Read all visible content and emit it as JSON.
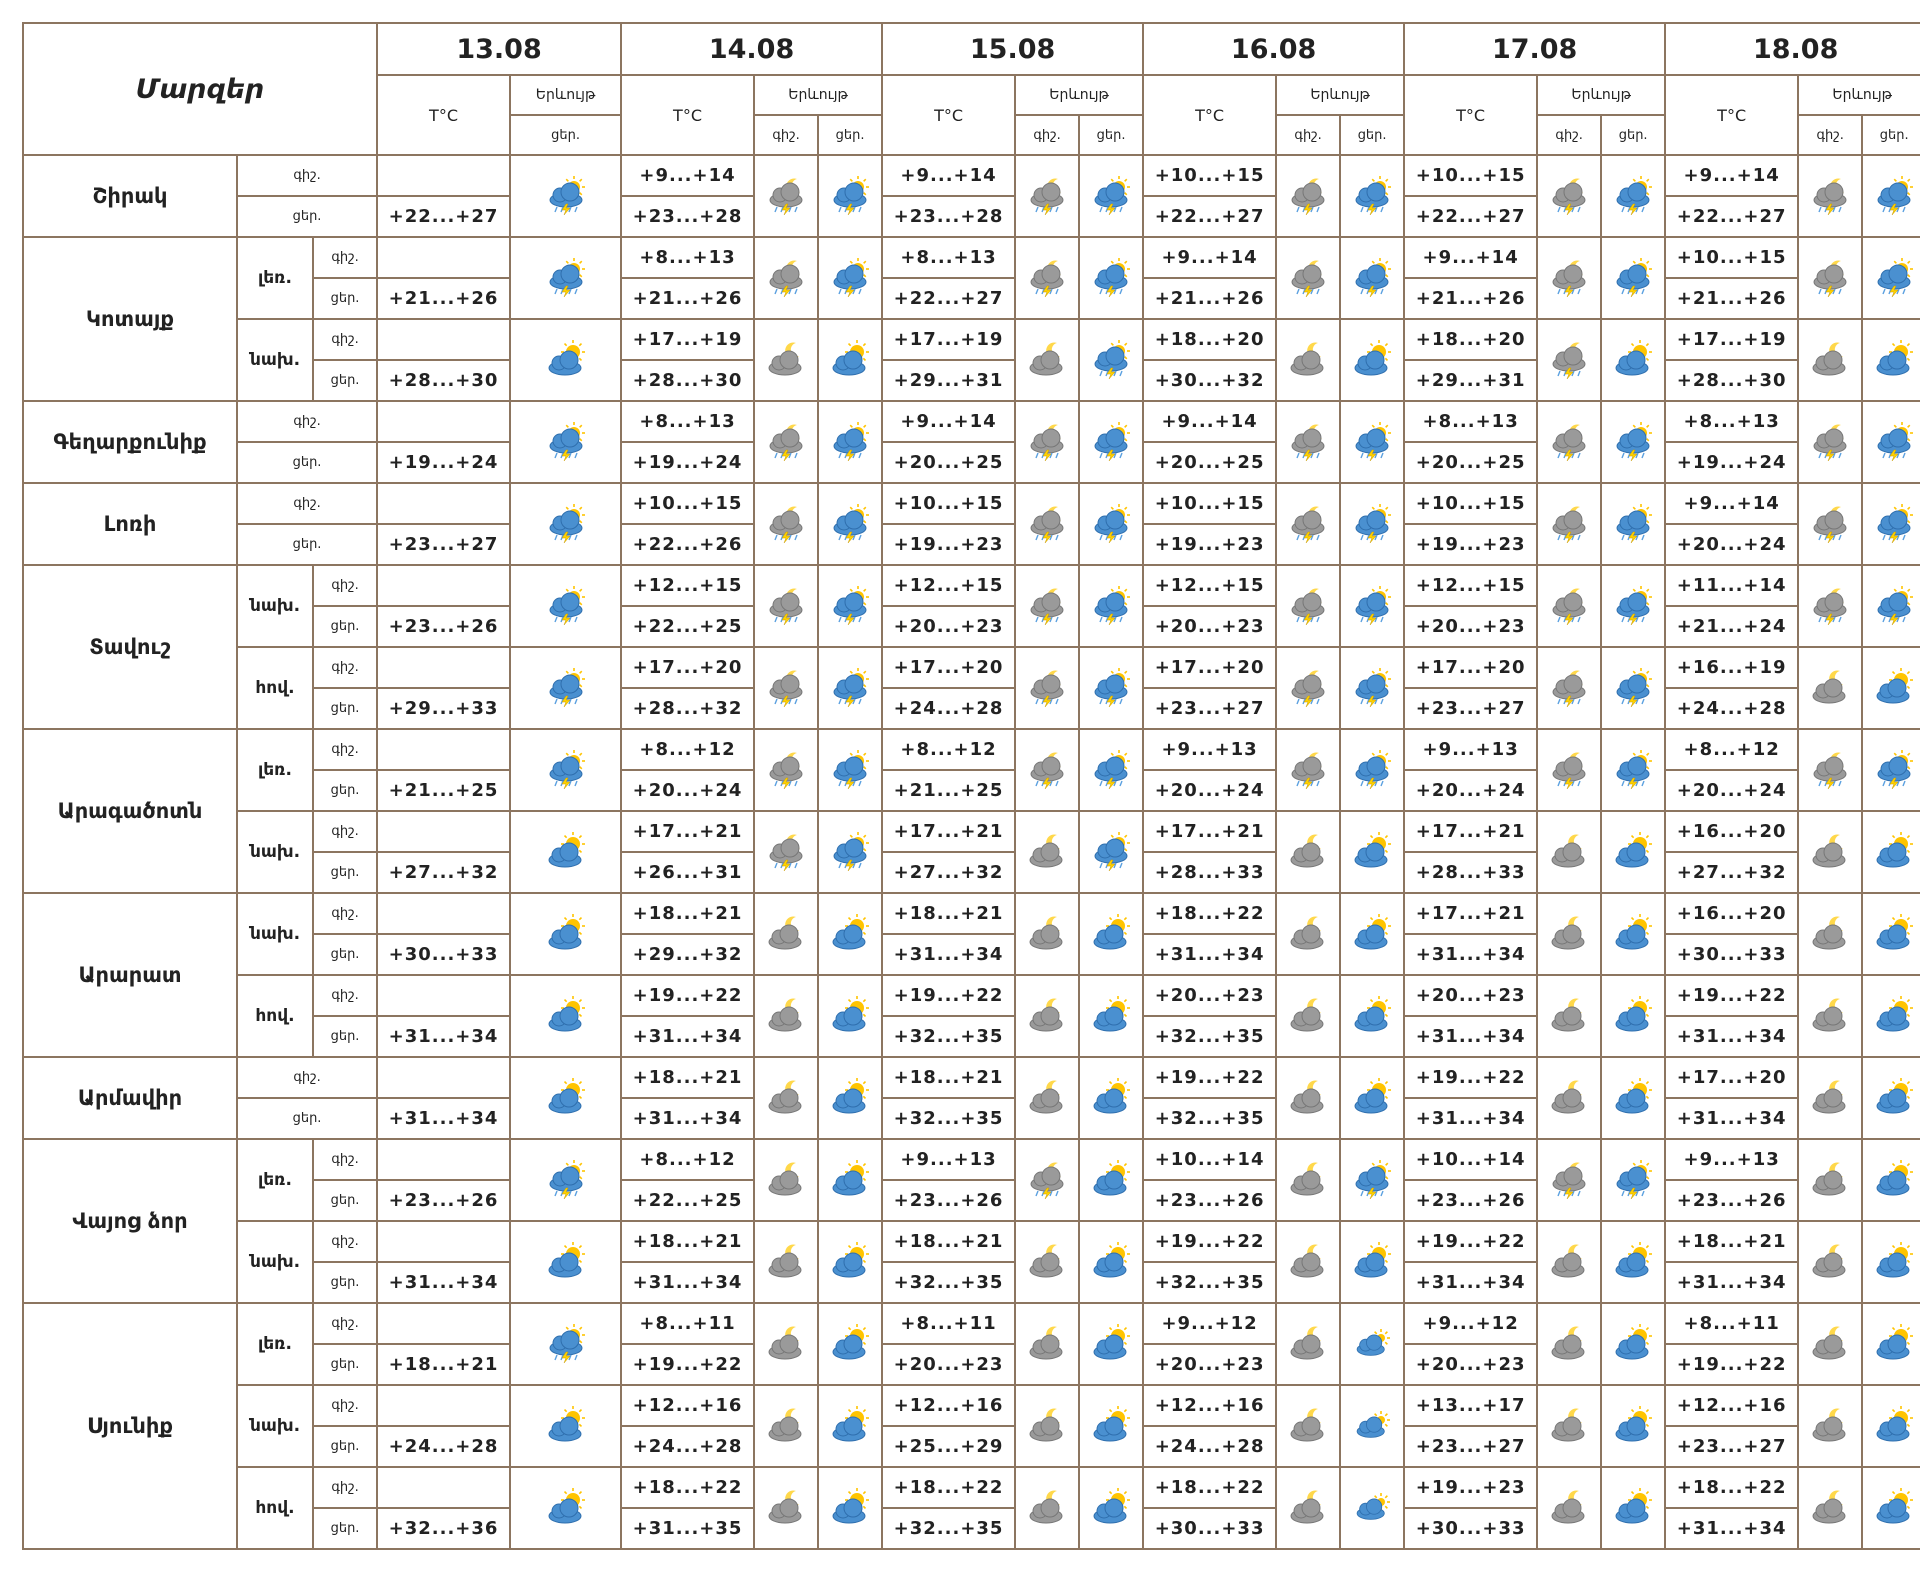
{
  "header": {
    "regions_label": "Մարզեր",
    "dates": [
      "13.08",
      "14.08",
      "15.08",
      "16.08",
      "17.08",
      "18.08"
    ],
    "temp_label": "T°C",
    "sky_label": "Երևույթ",
    "night": "գիշ.",
    "day": "ցեր."
  },
  "icon_types": {
    "storm-day": "partly sunny with lightning and rain",
    "storm-night": "night clouds with lightning and rain",
    "cloud-sun": "sun behind blue cloud",
    "cloud-moon": "moon behind grey cloud",
    "cloud-sun-small": "small sun behind blue cloud"
  },
  "colors": {
    "border": "#8c7560",
    "cloud_grey": "#9a9a9a",
    "cloud_blue": "#4a90d0",
    "sun": "#ffc400",
    "bolt": "#ffd200"
  },
  "regions": [
    {
      "name": "Շիրակ",
      "groups": [
        {
          "sub": "",
          "first": {
            "night": "",
            "day": "+22...+27",
            "icon": "storm-day"
          },
          "days": [
            {
              "night": "+9...+14",
              "day": "+23...+28",
              "ni": "storm-night",
              "di": "storm-day"
            },
            {
              "night": "+9...+14",
              "day": "+23...+28",
              "ni": "storm-night",
              "di": "storm-day"
            },
            {
              "night": "+10...+15",
              "day": "+22...+27",
              "ni": "storm-night",
              "di": "storm-day"
            },
            {
              "night": "+10...+15",
              "day": "+22...+27",
              "ni": "storm-night",
              "di": "storm-day"
            },
            {
              "night": "+9...+14",
              "day": "+22...+27",
              "ni": "storm-night",
              "di": "storm-day"
            }
          ]
        }
      ]
    },
    {
      "name": "Կոտայք",
      "groups": [
        {
          "sub": "լեռ.",
          "first": {
            "night": "",
            "day": "+21...+26",
            "icon": "storm-day"
          },
          "days": [
            {
              "night": "+8...+13",
              "day": "+21...+26",
              "ni": "storm-night",
              "di": "storm-day"
            },
            {
              "night": "+8...+13",
              "day": "+22...+27",
              "ni": "storm-night",
              "di": "storm-day"
            },
            {
              "night": "+9...+14",
              "day": "+21...+26",
              "ni": "storm-night",
              "di": "storm-day"
            },
            {
              "night": "+9...+14",
              "day": "+21...+26",
              "ni": "storm-night",
              "di": "storm-day"
            },
            {
              "night": "+10...+15",
              "day": "+21...+26",
              "ni": "storm-night",
              "di": "storm-day"
            }
          ]
        },
        {
          "sub": "նախ.",
          "first": {
            "night": "",
            "day": "+28...+30",
            "icon": "cloud-sun"
          },
          "days": [
            {
              "night": "+17...+19",
              "day": "+28...+30",
              "ni": "cloud-moon",
              "di": "cloud-sun"
            },
            {
              "night": "+17...+19",
              "day": "+29...+31",
              "ni": "cloud-moon",
              "di": "storm-day"
            },
            {
              "night": "+18...+20",
              "day": "+30...+32",
              "ni": "cloud-moon",
              "di": "cloud-sun"
            },
            {
              "night": "+18...+20",
              "day": "+29...+31",
              "ni": "storm-night",
              "di": "cloud-sun"
            },
            {
              "night": "+17...+19",
              "day": "+28...+30",
              "ni": "cloud-moon",
              "di": "cloud-sun"
            }
          ]
        }
      ]
    },
    {
      "name": "Գեղարքունիք",
      "groups": [
        {
          "sub": "",
          "first": {
            "night": "",
            "day": "+19...+24",
            "icon": "storm-day"
          },
          "days": [
            {
              "night": "+8...+13",
              "day": "+19...+24",
              "ni": "storm-night",
              "di": "storm-day"
            },
            {
              "night": "+9...+14",
              "day": "+20...+25",
              "ni": "storm-night",
              "di": "storm-day"
            },
            {
              "night": "+9...+14",
              "day": "+20...+25",
              "ni": "storm-night",
              "di": "storm-day"
            },
            {
              "night": "+8...+13",
              "day": "+20...+25",
              "ni": "storm-night",
              "di": "storm-day"
            },
            {
              "night": "+8...+13",
              "day": "+19...+24",
              "ni": "storm-night",
              "di": "storm-day"
            }
          ]
        }
      ]
    },
    {
      "name": "Լոռի",
      "groups": [
        {
          "sub": "",
          "first": {
            "night": "",
            "day": "+23...+27",
            "icon": "storm-day"
          },
          "days": [
            {
              "night": "+10...+15",
              "day": "+22...+26",
              "ni": "storm-night",
              "di": "storm-day"
            },
            {
              "night": "+10...+15",
              "day": "+19...+23",
              "ni": "storm-night",
              "di": "storm-day"
            },
            {
              "night": "+10...+15",
              "day": "+19...+23",
              "ni": "storm-night",
              "di": "storm-day"
            },
            {
              "night": "+10...+15",
              "day": "+19...+23",
              "ni": "storm-night",
              "di": "storm-day"
            },
            {
              "night": "+9...+14",
              "day": "+20...+24",
              "ni": "storm-night",
              "di": "storm-day"
            }
          ]
        }
      ]
    },
    {
      "name": "Տավուշ",
      "groups": [
        {
          "sub": "նախ.",
          "first": {
            "night": "",
            "day": "+23...+26",
            "icon": "storm-day"
          },
          "days": [
            {
              "night": "+12...+15",
              "day": "+22...+25",
              "ni": "storm-night",
              "di": "storm-day"
            },
            {
              "night": "+12...+15",
              "day": "+20...+23",
              "ni": "storm-night",
              "di": "storm-day"
            },
            {
              "night": "+12...+15",
              "day": "+20...+23",
              "ni": "storm-night",
              "di": "storm-day"
            },
            {
              "night": "+12...+15",
              "day": "+20...+23",
              "ni": "storm-night",
              "di": "storm-day"
            },
            {
              "night": "+11...+14",
              "day": "+21...+24",
              "ni": "storm-night",
              "di": "storm-day"
            }
          ]
        },
        {
          "sub": "հով.",
          "first": {
            "night": "",
            "day": "+29...+33",
            "icon": "storm-day"
          },
          "days": [
            {
              "night": "+17...+20",
              "day": "+28...+32",
              "ni": "storm-night",
              "di": "storm-day"
            },
            {
              "night": "+17...+20",
              "day": "+24...+28",
              "ni": "storm-night",
              "di": "storm-day"
            },
            {
              "night": "+17...+20",
              "day": "+23...+27",
              "ni": "storm-night",
              "di": "storm-day"
            },
            {
              "night": "+17...+20",
              "day": "+23...+27",
              "ni": "storm-night",
              "di": "storm-day"
            },
            {
              "night": "+16...+19",
              "day": "+24...+28",
              "ni": "cloud-moon",
              "di": "cloud-sun"
            }
          ]
        }
      ]
    },
    {
      "name": "Արագածոտն",
      "groups": [
        {
          "sub": "լեռ.",
          "first": {
            "night": "",
            "day": "+21...+25",
            "icon": "storm-day"
          },
          "days": [
            {
              "night": "+8...+12",
              "day": "+20...+24",
              "ni": "storm-night",
              "di": "storm-day"
            },
            {
              "night": "+8...+12",
              "day": "+21...+25",
              "ni": "storm-night",
              "di": "storm-day"
            },
            {
              "night": "+9...+13",
              "day": "+20...+24",
              "ni": "storm-night",
              "di": "storm-day"
            },
            {
              "night": "+9...+13",
              "day": "+20...+24",
              "ni": "storm-night",
              "di": "storm-day"
            },
            {
              "night": "+8...+12",
              "day": "+20...+24",
              "ni": "storm-night",
              "di": "storm-day"
            }
          ]
        },
        {
          "sub": "նախ.",
          "first": {
            "night": "",
            "day": "+27...+32",
            "icon": "cloud-sun"
          },
          "days": [
            {
              "night": "+17...+21",
              "day": "+26...+31",
              "ni": "storm-night",
              "di": "storm-day"
            },
            {
              "night": "+17...+21",
              "day": "+27...+32",
              "ni": "cloud-moon",
              "di": "storm-day"
            },
            {
              "night": "+17...+21",
              "day": "+28...+33",
              "ni": "cloud-moon",
              "di": "cloud-sun"
            },
            {
              "night": "+17...+21",
              "day": "+28...+33",
              "ni": "cloud-moon",
              "di": "cloud-sun"
            },
            {
              "night": "+16...+20",
              "day": "+27...+32",
              "ni": "cloud-moon",
              "di": "cloud-sun"
            }
          ]
        }
      ]
    },
    {
      "name": "Արարատ",
      "groups": [
        {
          "sub": "նախ.",
          "first": {
            "night": "",
            "day": "+30...+33",
            "icon": "cloud-sun"
          },
          "days": [
            {
              "night": "+18...+21",
              "day": "+29...+32",
              "ni": "cloud-moon",
              "di": "cloud-sun"
            },
            {
              "night": "+18...+21",
              "day": "+31...+34",
              "ni": "cloud-moon",
              "di": "cloud-sun"
            },
            {
              "night": "+18...+22",
              "day": "+31...+34",
              "ni": "cloud-moon",
              "di": "cloud-sun"
            },
            {
              "night": "+17...+21",
              "day": "+31...+34",
              "ni": "cloud-moon",
              "di": "cloud-sun"
            },
            {
              "night": "+16...+20",
              "day": "+30...+33",
              "ni": "cloud-moon",
              "di": "cloud-sun"
            }
          ]
        },
        {
          "sub": "հով.",
          "first": {
            "night": "",
            "day": "+31...+34",
            "icon": "cloud-sun"
          },
          "days": [
            {
              "night": "+19...+22",
              "day": "+31...+34",
              "ni": "cloud-moon",
              "di": "cloud-sun"
            },
            {
              "night": "+19...+22",
              "day": "+32...+35",
              "ni": "cloud-moon",
              "di": "cloud-sun"
            },
            {
              "night": "+20...+23",
              "day": "+32...+35",
              "ni": "cloud-moon",
              "di": "cloud-sun"
            },
            {
              "night": "+20...+23",
              "day": "+31...+34",
              "ni": "cloud-moon",
              "di": "cloud-sun"
            },
            {
              "night": "+19...+22",
              "day": "+31...+34",
              "ni": "cloud-moon",
              "di": "cloud-sun"
            }
          ]
        }
      ]
    },
    {
      "name": "Արմավիր",
      "groups": [
        {
          "sub": "",
          "first": {
            "night": "",
            "day": "+31...+34",
            "icon": "cloud-sun"
          },
          "days": [
            {
              "night": "+18...+21",
              "day": "+31...+34",
              "ni": "cloud-moon",
              "di": "cloud-sun"
            },
            {
              "night": "+18...+21",
              "day": "+32...+35",
              "ni": "cloud-moon",
              "di": "cloud-sun"
            },
            {
              "night": "+19...+22",
              "day": "+32...+35",
              "ni": "cloud-moon",
              "di": "cloud-sun"
            },
            {
              "night": "+19...+22",
              "day": "+31...+34",
              "ni": "cloud-moon",
              "di": "cloud-sun"
            },
            {
              "night": "+17...+20",
              "day": "+31...+34",
              "ni": "cloud-moon",
              "di": "cloud-sun"
            }
          ]
        }
      ]
    },
    {
      "name": "Վայոց ձոր",
      "groups": [
        {
          "sub": "լեռ.",
          "first": {
            "night": "",
            "day": "+23...+26",
            "icon": "storm-day"
          },
          "days": [
            {
              "night": "+8...+12",
              "day": "+22...+25",
              "ni": "cloud-moon",
              "di": "cloud-sun"
            },
            {
              "night": "+9...+13",
              "day": "+23...+26",
              "ni": "storm-night",
              "di": "cloud-sun"
            },
            {
              "night": "+10...+14",
              "day": "+23...+26",
              "ni": "cloud-moon",
              "di": "storm-day"
            },
            {
              "night": "+10...+14",
              "day": "+23...+26",
              "ni": "storm-night",
              "di": "storm-day"
            },
            {
              "night": "+9...+13",
              "day": "+23...+26",
              "ni": "cloud-moon",
              "di": "cloud-sun"
            }
          ]
        },
        {
          "sub": "նախ.",
          "first": {
            "night": "",
            "day": "+31...+34",
            "icon": "cloud-sun"
          },
          "days": [
            {
              "night": "+18...+21",
              "day": "+31...+34",
              "ni": "cloud-moon",
              "di": "cloud-sun"
            },
            {
              "night": "+18...+21",
              "day": "+32...+35",
              "ni": "cloud-moon",
              "di": "cloud-sun"
            },
            {
              "night": "+19...+22",
              "day": "+32...+35",
              "ni": "cloud-moon",
              "di": "cloud-sun"
            },
            {
              "night": "+19...+22",
              "day": "+31...+34",
              "ni": "cloud-moon",
              "di": "cloud-sun"
            },
            {
              "night": "+18...+21",
              "day": "+31...+34",
              "ni": "cloud-moon",
              "di": "cloud-sun"
            }
          ]
        }
      ]
    },
    {
      "name": "Սյունիք",
      "groups": [
        {
          "sub": "լեռ.",
          "first": {
            "night": "",
            "day": "+18...+21",
            "icon": "storm-day"
          },
          "days": [
            {
              "night": "+8...+11",
              "day": "+19...+22",
              "ni": "cloud-moon",
              "di": "cloud-sun"
            },
            {
              "night": "+8...+11",
              "day": "+20...+23",
              "ni": "cloud-moon",
              "di": "cloud-sun"
            },
            {
              "night": "+9...+12",
              "day": "+20...+23",
              "ni": "cloud-moon",
              "di": "cloud-sun-small"
            },
            {
              "night": "+9...+12",
              "day": "+20...+23",
              "ni": "cloud-moon",
              "di": "cloud-sun"
            },
            {
              "night": "+8...+11",
              "day": "+19...+22",
              "ni": "cloud-moon",
              "di": "cloud-sun"
            }
          ]
        },
        {
          "sub": "նախ.",
          "first": {
            "night": "",
            "day": "+24...+28",
            "icon": "cloud-sun"
          },
          "days": [
            {
              "night": "+12...+16",
              "day": "+24...+28",
              "ni": "cloud-moon",
              "di": "cloud-sun"
            },
            {
              "night": "+12...+16",
              "day": "+25...+29",
              "ni": "cloud-moon",
              "di": "cloud-sun"
            },
            {
              "night": "+12...+16",
              "day": "+24...+28",
              "ni": "cloud-moon",
              "di": "cloud-sun-small"
            },
            {
              "night": "+13...+17",
              "day": "+23...+27",
              "ni": "cloud-moon",
              "di": "cloud-sun"
            },
            {
              "night": "+12...+16",
              "day": "+23...+27",
              "ni": "cloud-moon",
              "di": "cloud-sun"
            }
          ]
        },
        {
          "sub": "հով.",
          "first": {
            "night": "",
            "day": "+32...+36",
            "icon": "cloud-sun"
          },
          "days": [
            {
              "night": "+18...+22",
              "day": "+31...+35",
              "ni": "cloud-moon",
              "di": "cloud-sun"
            },
            {
              "night": "+18...+22",
              "day": "+32...+35",
              "ni": "cloud-moon",
              "di": "cloud-sun"
            },
            {
              "night": "+18...+22",
              "day": "+30...+33",
              "ni": "cloud-moon",
              "di": "cloud-sun-small"
            },
            {
              "night": "+19...+23",
              "day": "+30...+33",
              "ni": "cloud-moon",
              "di": "cloud-sun"
            },
            {
              "night": "+18...+22",
              "day": "+31...+34",
              "ni": "cloud-moon",
              "di": "cloud-sun"
            }
          ]
        }
      ]
    }
  ]
}
